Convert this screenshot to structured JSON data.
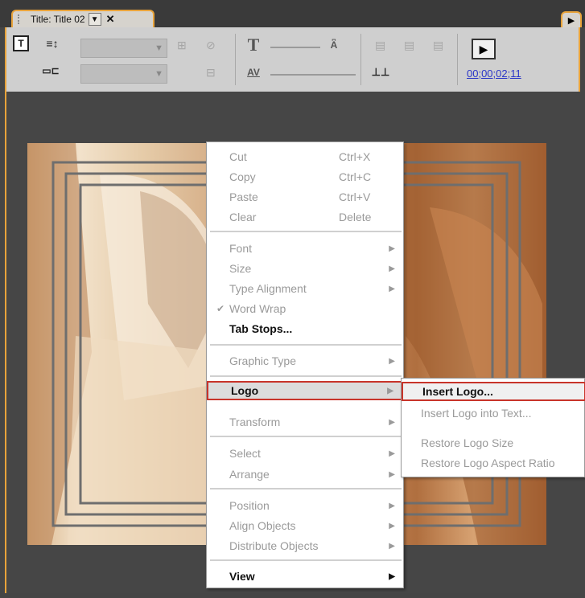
{
  "tab": {
    "title": "Title: Title 02",
    "menu_glyph": "▼",
    "close_glyph": "✕"
  },
  "panel_menu_glyph": "▶",
  "toolbar": {
    "timecode": "00;00;02;11",
    "icons": [
      "type-tool-icon",
      "vertical-text-icon",
      "path-text-icon",
      "font-icon",
      "kerning-icon",
      "tab-stops-icon",
      "play-icon"
    ]
  },
  "context_menu": {
    "groups": [
      [
        {
          "label": "Cut",
          "shortcut": "Ctrl+X",
          "enabled": false
        },
        {
          "label": "Copy",
          "shortcut": "Ctrl+C",
          "enabled": false
        },
        {
          "label": "Paste",
          "shortcut": "Ctrl+V",
          "enabled": false
        },
        {
          "label": "Clear",
          "shortcut": "Delete",
          "enabled": false
        }
      ],
      [
        {
          "label": "Font",
          "submenu": true,
          "enabled": false
        },
        {
          "label": "Size",
          "submenu": true,
          "enabled": false
        },
        {
          "label": "Type Alignment",
          "submenu": true,
          "enabled": false
        },
        {
          "label": "Word Wrap",
          "checked": true,
          "enabled": false
        },
        {
          "label": "Tab Stops...",
          "enabled": true
        }
      ],
      [
        {
          "label": "Graphic Type",
          "submenu": true,
          "enabled": false
        }
      ],
      [
        {
          "label": "Logo",
          "submenu": true,
          "enabled": true,
          "highlighted": true
        },
        {
          "label": "Transform",
          "submenu": true,
          "enabled": false
        }
      ],
      [
        {
          "label": "Select",
          "submenu": true,
          "enabled": false
        },
        {
          "label": "Arrange",
          "submenu": true,
          "enabled": false
        }
      ],
      [
        {
          "label": "Position",
          "submenu": true,
          "enabled": false
        },
        {
          "label": "Align Objects",
          "submenu": true,
          "enabled": false
        },
        {
          "label": "Distribute Objects",
          "submenu": true,
          "enabled": false
        }
      ],
      [
        {
          "label": "View",
          "submenu": true,
          "enabled": true
        }
      ]
    ],
    "submenu_glyph": "▶",
    "check_glyph": "✔"
  },
  "logo_submenu": {
    "items": [
      {
        "label": "Insert Logo...",
        "enabled": true,
        "highlighted": true
      },
      {
        "label": "Insert Logo into Text...",
        "enabled": false
      },
      {
        "label": "Restore Logo Size",
        "enabled": false
      },
      {
        "label": "Restore Logo Aspect Ratio",
        "enabled": false
      }
    ]
  },
  "colors": {
    "focus_border": "#e8a33a",
    "highlight_border": "#c8342a",
    "timecode": "#2a35c8"
  }
}
